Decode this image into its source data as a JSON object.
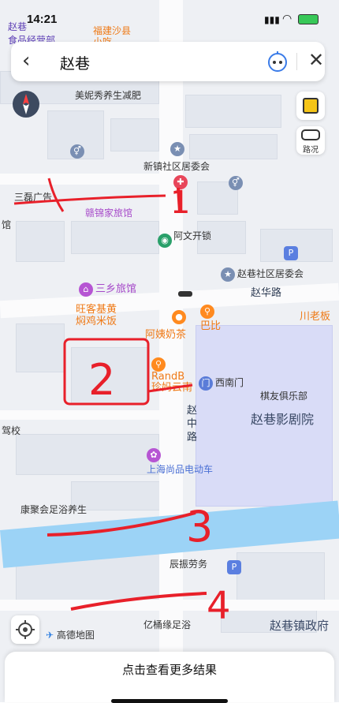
{
  "status_bar": {
    "time": "14:21"
  },
  "search": {
    "query": "赵巷",
    "back_label": "‹",
    "close_label": "✕"
  },
  "controls": {
    "layers_label": "",
    "traffic_label": "路况"
  },
  "roads": {
    "zhaohua": "赵华路",
    "zhaozhong": "赵中路"
  },
  "pois": {
    "top_left_shop": "赵巷",
    "top_left_shop2": "食品经营部",
    "fujian": "福建沙县",
    "fujian2": "小吃",
    "meini": "美妮秀养生减肥",
    "xinzhen": "新镇社区居委会",
    "sanlei": "三磊广告",
    "ganjin": "赣锦家旅馆",
    "awen": "阿文开锁",
    "sanxiang": "三乡旅馆",
    "zhaoxiang_juwei": "赵巷社区居委会",
    "wangke": "旺客基黄",
    "wangke2": "焖鸡米饭",
    "ayi": "阿姨奶茶",
    "baby": "巴比",
    "chuanlao": "川老板",
    "randb": "RandB",
    "randb2": "珍妈云南",
    "ximenmen": "西南门",
    "qiyou": "棋友俱乐部",
    "cinema": "赵巷影剧院",
    "jiaxiao": "驾校",
    "shanghai_ev": "上海尚品电动车",
    "kangju": "康聚会足浴养生",
    "chenzhen": "辰振劳务",
    "yitong": "亿桶缘足浴",
    "zhaoxiang_gov": "赵巷镇政府",
    "gaode": "高德地图",
    "guan": "馆",
    "nan": "南门"
  },
  "annotations": {
    "n1": "1",
    "n2": "2",
    "n3": "3",
    "n4": "4"
  },
  "bottom": {
    "more_results": "点击查看更多结果"
  },
  "colors": {
    "accent": "#ef7a17",
    "water": "#9cd3f6",
    "cinema_area": "#d9dcf7",
    "annotation": "#e8202a"
  }
}
